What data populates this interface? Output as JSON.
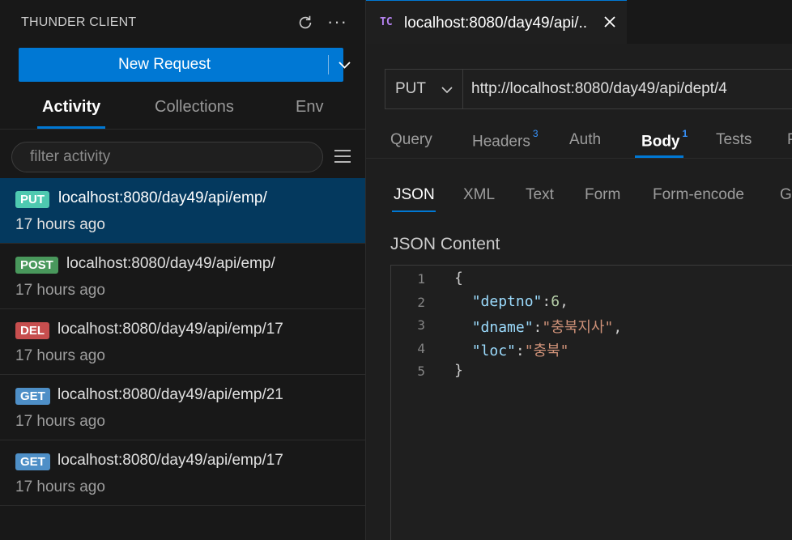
{
  "sidebar": {
    "title": "THUNDER CLIENT",
    "new_request_label": "New Request",
    "tabs": [
      {
        "label": "Activity",
        "active": true
      },
      {
        "label": "Collections",
        "active": false
      },
      {
        "label": "Env",
        "active": false
      }
    ],
    "filter_placeholder": "filter activity",
    "activity": [
      {
        "method": "PUT",
        "color": "#4ec9b0",
        "url": "localhost:8080/day49/api/emp/",
        "time": "17 hours ago",
        "selected": true
      },
      {
        "method": "POST",
        "color": "#49985c",
        "url": "localhost:8080/day49/api/emp/",
        "time": "17 hours ago",
        "selected": false
      },
      {
        "method": "DEL",
        "color": "#c74e4e",
        "url": "localhost:8080/day49/api/emp/17",
        "time": "17 hours ago",
        "selected": false
      },
      {
        "method": "GET",
        "color": "#4e8fc7",
        "url": "localhost:8080/day49/api/emp/21",
        "time": "17 hours ago",
        "selected": false
      },
      {
        "method": "GET",
        "color": "#4e8fc7",
        "url": "localhost:8080/day49/api/emp/17",
        "time": "17 hours ago",
        "selected": false
      }
    ]
  },
  "editor_tab": {
    "icon_text": "TC",
    "title": "localhost:8080/day49/api/.."
  },
  "request": {
    "method": "PUT",
    "url": "http://localhost:8080/day49/api/dept/4",
    "tabs": [
      {
        "label": "Query",
        "badge": ""
      },
      {
        "label": "Headers",
        "badge": "3"
      },
      {
        "label": "Auth",
        "badge": ""
      },
      {
        "label": "Body",
        "badge": "1"
      },
      {
        "label": "Tests",
        "badge": ""
      },
      {
        "label": "P",
        "badge": ""
      }
    ],
    "active_tab": "Body"
  },
  "body": {
    "tabs": [
      "JSON",
      "XML",
      "Text",
      "Form",
      "Form-encode",
      "G"
    ],
    "active_tab": "JSON",
    "content_label": "JSON Content",
    "line_numbers": [
      "1",
      "2",
      "3",
      "4",
      "5"
    ],
    "code": {
      "open": "{",
      "key1": "\"deptno\"",
      "val1": "6",
      "key2": "\"dname\"",
      "val2": "\"충북지사\"",
      "key3": "\"loc\"",
      "val3": "\"충북\"",
      "close": "}"
    }
  },
  "colors": {
    "accent": "#0078d4",
    "selected_row": "#04395e"
  }
}
